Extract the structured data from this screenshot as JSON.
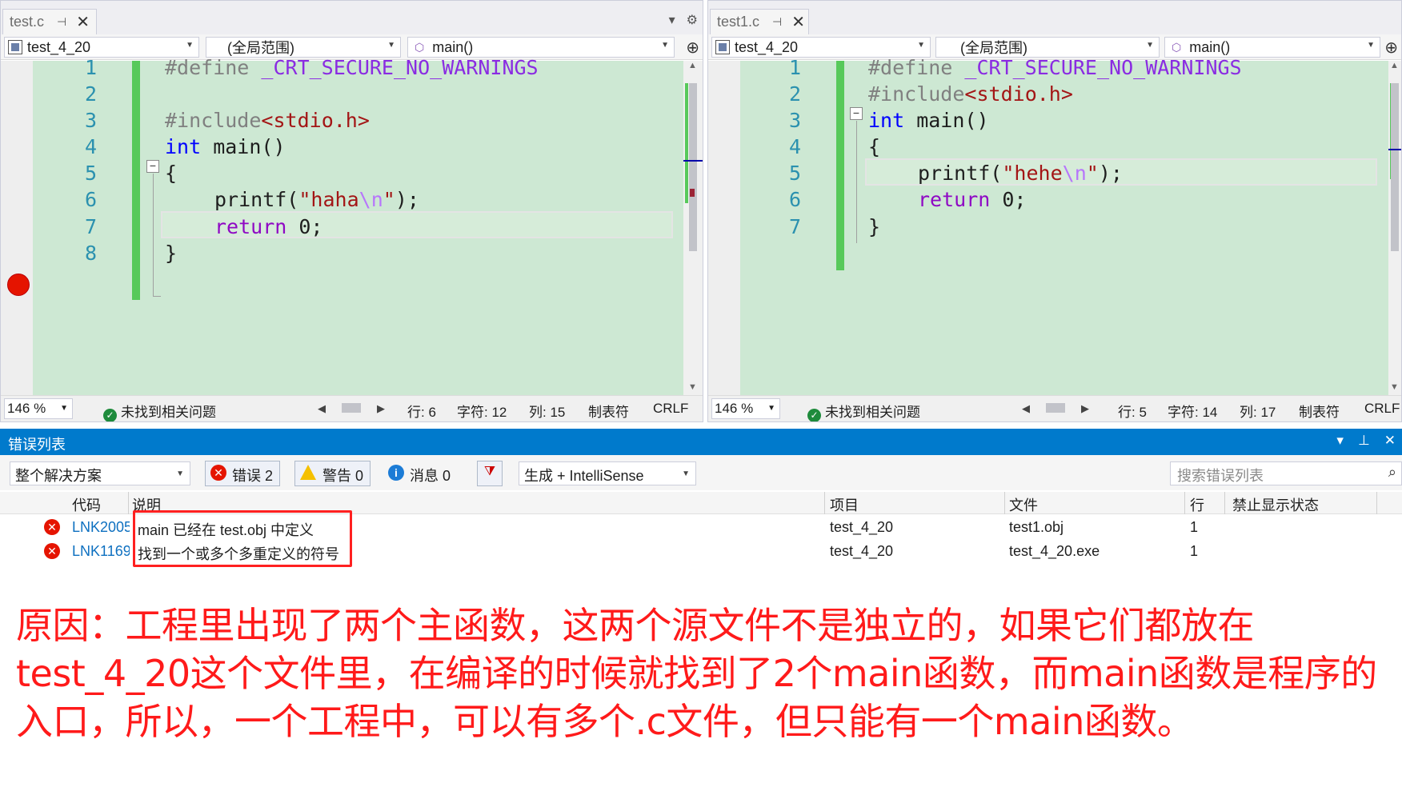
{
  "left_editor": {
    "tab_title": "test.c",
    "project": "test_4_20",
    "scope": "(全局范围)",
    "member": "main()",
    "line_numbers": [
      "1",
      "2",
      "3",
      "4",
      "5",
      "6",
      "7",
      "8"
    ],
    "status": {
      "zoom": "146 %",
      "issues": "未找到相关问题",
      "row": "行: 6",
      "char": "字符: 12",
      "col": "列: 15",
      "tabs": "制表符",
      "eol": "CRLF"
    }
  },
  "right_editor": {
    "tab_title": "test1.c",
    "project": "test_4_20",
    "scope": "(全局范围)",
    "member": "main()",
    "line_numbers": [
      "1",
      "2",
      "3",
      "4",
      "5",
      "6",
      "7"
    ],
    "status": {
      "zoom": "146 %",
      "issues": "未找到相关问题",
      "row": "行: 5",
      "char": "字符: 14",
      "col": "列: 17",
      "tabs": "制表符",
      "eol": "CRLF"
    }
  },
  "code": {
    "define_kw": "#define",
    "define_name": "_CRT_SECURE_NO_WARNINGS",
    "include_kw": "#include",
    "include_open": "<",
    "include_file": "stdio.h",
    "include_close": ">",
    "int_kw": "int",
    "main_sig": " main()",
    "open_brace": "{",
    "close_brace": "}",
    "printf_fn": "printf(",
    "quote": "\"",
    "left_string": "haha",
    "right_string": "hehe",
    "escape": "\\n",
    "printf_end": ");",
    "return_kw": "return",
    "return_val": " 0;"
  },
  "error_list": {
    "title": "错误列表",
    "scope": "整个解决方案",
    "errors_btn": "错误 2",
    "warnings_btn": "警告 0",
    "messages_btn": "消息 0",
    "build_filter": "生成 + IntelliSense",
    "search_placeholder": "搜索错误列表",
    "columns": {
      "code": "代码",
      "desc": "说明",
      "project": "项目",
      "file": "文件",
      "line": "行",
      "suppress": "禁止显示状态"
    },
    "rows": [
      {
        "code": "LNK2005",
        "desc": "main 已经在 test.obj 中定义",
        "project": "test_4_20",
        "file": "test1.obj",
        "line": "1"
      },
      {
        "code": "LNK1169",
        "desc": "找到一个或多个多重定义的符号",
        "project": "test_4_20",
        "file": "test_4_20.exe",
        "line": "1"
      }
    ]
  },
  "annotation": "原因：工程里出现了两个主函数，这两个源文件不是独立的，如果它们都放在test_4_20这个文件里，在编译的时候就找到了2个main函数，而main函数是程序的入口，所以，一个工程中，可以有多个.c文件，但只能有一个main函数。",
  "colors": {
    "editor_bg": "#cde8d3",
    "accent": "#007acc",
    "annotation": "#ff1a1a",
    "breakpoint": "#e51400",
    "change_bar": "#57c95a"
  }
}
